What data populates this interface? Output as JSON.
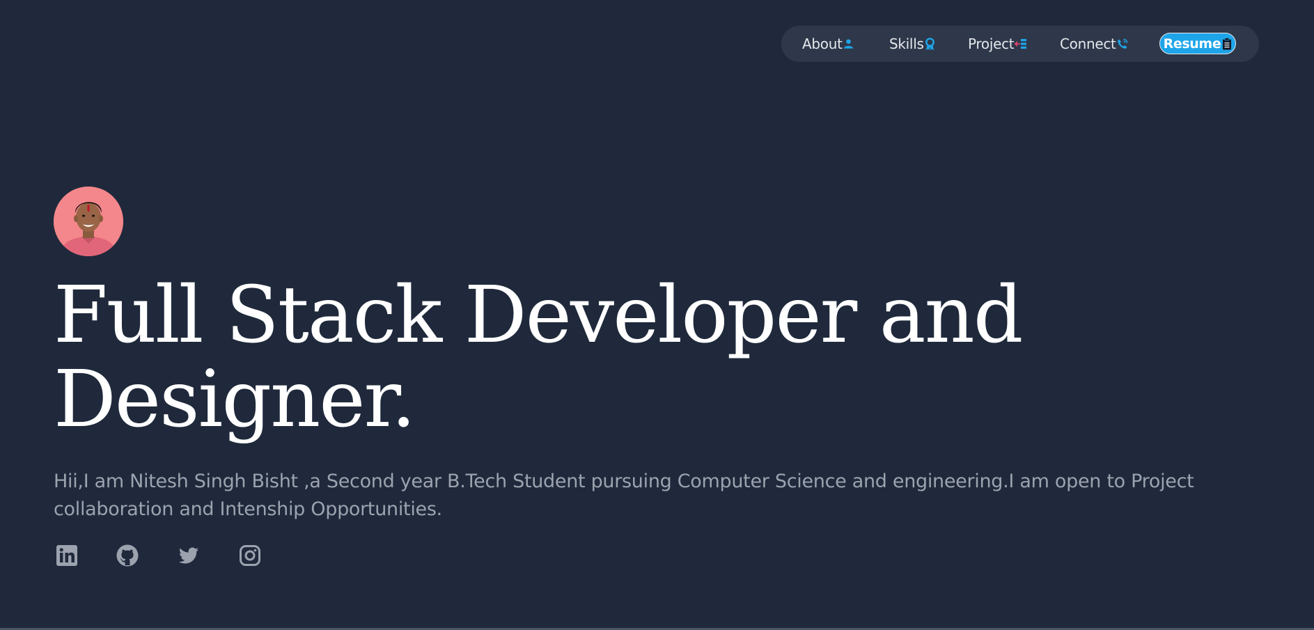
{
  "nav": {
    "items": [
      {
        "label": "About",
        "icon": "person-icon"
      },
      {
        "label": "Skills",
        "icon": "award-icon"
      },
      {
        "label": "Project",
        "icon": "project-icon"
      },
      {
        "label": "Connect",
        "icon": "phone-icon"
      }
    ],
    "resume": {
      "label": "Resume",
      "icon": "clipboard-icon"
    }
  },
  "hero": {
    "avatar_alt": "Profile photo",
    "headline": "Full Stack Developer and Designer.",
    "intro": "Hii,I am Nitesh Singh Bisht ,a Second year B.Tech Student pursuing Computer Science and engineering.I am open to Project collaboration and Intenship Opportunities."
  },
  "social": [
    {
      "name": "LinkedIn",
      "icon": "linkedin-icon"
    },
    {
      "name": "GitHub",
      "icon": "github-icon"
    },
    {
      "name": "Twitter",
      "icon": "twitter-icon"
    },
    {
      "name": "Instagram",
      "icon": "instagram-icon"
    }
  ],
  "colors": {
    "background": "#1f293b",
    "nav_bg": "#2e384a",
    "accent": "#1ea5e9",
    "text_muted": "#9ca3af",
    "icon_gray": "#9ca3af"
  }
}
